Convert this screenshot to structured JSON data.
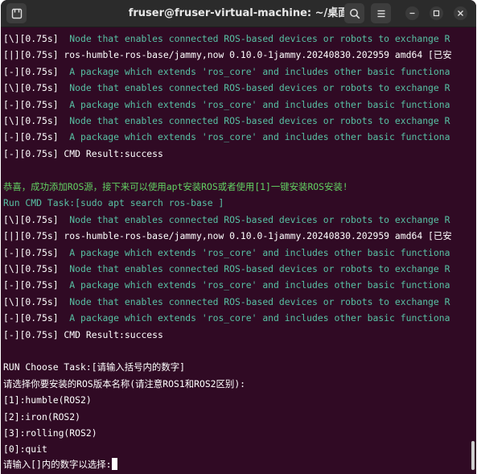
{
  "window": {
    "title": "fruser@fruser-virtual-machine: ~/桌面"
  },
  "toolbar": {
    "new_tab_icon": "new-tab-icon",
    "search_icon": "search-icon",
    "menu_icon": "hamburger-menu-icon"
  },
  "colors": {
    "terminal_bg": "#300a24",
    "titlebar_bg": "#2b2b2b",
    "output_cyan": "#57c1a4",
    "output_green": "#62d162"
  },
  "terminal": {
    "lines": [
      {
        "prefix": "[\\][0.75s]",
        "text": "  Node that enables connected ROS-based devices or robots to exchange R"
      },
      {
        "prefix": "[|][0.75s]",
        "text": " ros-humble-ros-base/jammy,now 0.10.0-1jammy.20240830.202959 amd64 [已安"
      },
      {
        "prefix": "[-][0.75s]",
        "text": "  A package which extends 'ros_core' and includes other basic functiona"
      },
      {
        "prefix": "[\\][0.75s]",
        "text": "  Node that enables connected ROS-based devices or robots to exchange R"
      },
      {
        "prefix": "[-][0.75s]",
        "text": "  A package which extends 'ros_core' and includes other basic functiona"
      },
      {
        "prefix": "[\\][0.75s]",
        "text": "  Node that enables connected ROS-based devices or robots to exchange R"
      },
      {
        "prefix": "[-][0.75s]",
        "text": "  A package which extends 'ros_core' and includes other basic functiona"
      },
      {
        "prefix": "[-][0.75s]",
        "text": " CMD Result:success"
      },
      {
        "prefix": "",
        "text": ""
      },
      {
        "prefix": "",
        "text": "恭喜，成功添加ROS源，接下来可以使用apt安装ROS或者使用[1]一键安装ROS安装!"
      },
      {
        "prefix": "",
        "text": "Run CMD Task:[sudo apt search ros-base ]"
      },
      {
        "prefix": "[\\][0.75s]",
        "text": "  Node that enables connected ROS-based devices or robots to exchange R"
      },
      {
        "prefix": "[|][0.75s]",
        "text": " ros-humble-ros-base/jammy,now 0.10.0-1jammy.20240830.202959 amd64 [已安"
      },
      {
        "prefix": "[-][0.75s]",
        "text": "  A package which extends 'ros_core' and includes other basic functiona"
      },
      {
        "prefix": "[\\][0.75s]",
        "text": "  Node that enables connected ROS-based devices or robots to exchange R"
      },
      {
        "prefix": "[-][0.75s]",
        "text": "  A package which extends 'ros_core' and includes other basic functiona"
      },
      {
        "prefix": "[\\][0.75s]",
        "text": "  Node that enables connected ROS-based devices or robots to exchange R"
      },
      {
        "prefix": "[-][0.75s]",
        "text": "  A package which extends 'ros_core' and includes other basic functiona"
      },
      {
        "prefix": "[-][0.75s]",
        "text": " CMD Result:success"
      },
      {
        "prefix": "",
        "text": ""
      },
      {
        "prefix": "",
        "text": "RUN Choose Task:[请输入括号内的数字]"
      },
      {
        "prefix": "",
        "text": "请选择你要安装的ROS版本名称(请注意ROS1和ROS2区别):"
      },
      {
        "prefix": "",
        "text": "[1]:humble(ROS2)"
      },
      {
        "prefix": "",
        "text": "[2]:iron(ROS2)"
      },
      {
        "prefix": "",
        "text": "[3]:rolling(ROS2)"
      },
      {
        "prefix": "",
        "text": "[0]:quit"
      },
      {
        "prefix": "",
        "text": "请输入[]内的数字以选择:"
      }
    ]
  }
}
